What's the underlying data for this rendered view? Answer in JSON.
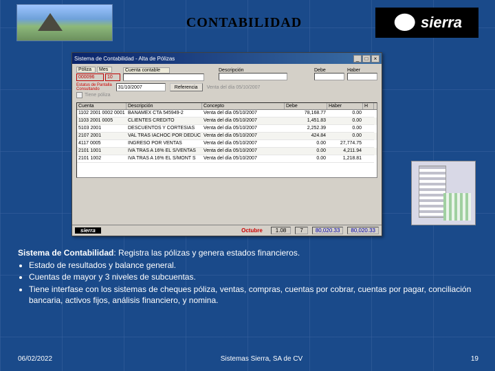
{
  "slide": {
    "title": "CONTABILIDAD",
    "sierra_brand": "sierra"
  },
  "window": {
    "title": "Sistema de Contabilidad - Alta de Pólizas",
    "min": "_",
    "max": "□",
    "close": "×",
    "labels": {
      "poliza": "Póliza",
      "mes": "Mes",
      "poliza_val": "000096",
      "mes_val": "10",
      "cuenta_contable": "Cuenta contable",
      "descripcion_hdr": "Descripción",
      "debe_hdr": "Debe",
      "haber_hdr": "Haber",
      "estado": "Estatus de Pantalla",
      "estado_val": "Consultando",
      "fecha": "31/10/2007",
      "ref_btn": "Referencia",
      "venta_dia": "Venta del día 05/10/2007",
      "check": "Tiene póliza"
    },
    "grid": {
      "cols": [
        "Cuenta",
        "Descripción",
        "Concepto",
        "Debe",
        "Haber",
        "H"
      ],
      "rows": [
        {
          "cuenta": "1102 2001 0002 0001",
          "desc": "BANAMEX CTA 545949-2",
          "concepto": "Venta del día 05/10/2007",
          "debe": "78,168.77",
          "haber": "0.00"
        },
        {
          "cuenta": "1103 2001 0005",
          "desc": "CLIENTES CREDITO",
          "concepto": "Venta del día 05/10/2007",
          "debe": "1,451.83",
          "haber": "0.00"
        },
        {
          "cuenta": "5103 2001",
          "desc": "DESCUENTOS Y CORTESIAS",
          "concepto": "Venta del día 05/10/2007",
          "debe": "2,252.39",
          "haber": "0.00"
        },
        {
          "cuenta": "2107 2001",
          "desc": "VAL TRAS IACHOC POR DEDUC S.A",
          "concepto": "Venta del día 05/10/2007",
          "debe": "424.84",
          "haber": "0.00"
        },
        {
          "cuenta": "4117 0005",
          "desc": "INGRESO POR VENTAS",
          "concepto": "Venta del día 05/10/2007",
          "debe": "0.00",
          "haber": "27,774.75"
        },
        {
          "cuenta": "2101 1001",
          "desc": "IVA TRAS A 16% EL S/VENTAS",
          "concepto": "Venta del día 05/10/2007",
          "debe": "0.00",
          "haber": "4,211.94"
        },
        {
          "cuenta": "2101 1002",
          "desc": "IVA TRAS A 16% EL S/MONT S",
          "concepto": "Venta del día 05/10/2007",
          "debe": "0.00",
          "haber": "1,218.81"
        }
      ]
    },
    "status": {
      "brand": "sierra",
      "month": "Octubre",
      "page1": "1.08",
      "page2": "7",
      "total_debe": "80,020.33",
      "total_haber": "80,020.33"
    }
  },
  "description": {
    "lead_b": "Sistema de Contabilidad",
    "lead_rest": ":  Registra las  pólizas y genera estados financieros.",
    "bullets": [
      "Estado de resultados y balance general.",
      "Cuentas de mayor y 3 niveles de subcuentas.",
      "Tiene interfase con los sistemas de cheques póliza, ventas, compras, cuentas por cobrar, cuentas por pagar, conciliación bancaria, activos fijos, análisis financiero, y nomina."
    ]
  },
  "footer": {
    "date": "06/02/2022",
    "company": "Sistemas Sierra, SA de CV",
    "page": "19"
  }
}
